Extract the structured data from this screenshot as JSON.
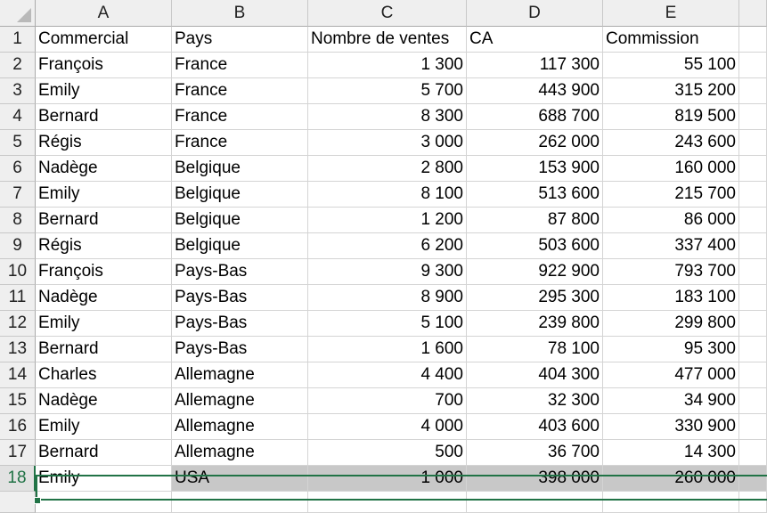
{
  "columns": [
    "A",
    "B",
    "C",
    "D",
    "E"
  ],
  "selected_row": "18",
  "rows": [
    {
      "n": "1",
      "a": "Commercial",
      "b": "Pays",
      "c": "Nombre de ventes",
      "d": "CA",
      "e": "Commission"
    },
    {
      "n": "2",
      "a": "François",
      "b": "France",
      "c": "1 300",
      "d": "117 300",
      "e": "55 100"
    },
    {
      "n": "3",
      "a": "Emily",
      "b": "France",
      "c": "5 700",
      "d": "443 900",
      "e": "315 200"
    },
    {
      "n": "4",
      "a": "Bernard",
      "b": "France",
      "c": "8 300",
      "d": "688 700",
      "e": "819 500"
    },
    {
      "n": "5",
      "a": "Régis",
      "b": "France",
      "c": "3 000",
      "d": "262 000",
      "e": "243 600"
    },
    {
      "n": "6",
      "a": "Nadège",
      "b": "Belgique",
      "c": "2 800",
      "d": "153 900",
      "e": "160 000"
    },
    {
      "n": "7",
      "a": "Emily",
      "b": "Belgique",
      "c": "8 100",
      "d": "513 600",
      "e": "215 700"
    },
    {
      "n": "8",
      "a": "Bernard",
      "b": "Belgique",
      "c": "1 200",
      "d": "87 800",
      "e": "86 000"
    },
    {
      "n": "9",
      "a": "Régis",
      "b": "Belgique",
      "c": "6 200",
      "d": "503 600",
      "e": "337 400"
    },
    {
      "n": "10",
      "a": "François",
      "b": "Pays-Bas",
      "c": "9 300",
      "d": "922 900",
      "e": "793 700"
    },
    {
      "n": "11",
      "a": "Nadège",
      "b": "Pays-Bas",
      "c": "8 900",
      "d": "295 300",
      "e": "183 100"
    },
    {
      "n": "12",
      "a": "Emily",
      "b": "Pays-Bas",
      "c": "5 100",
      "d": "239 800",
      "e": "299 800"
    },
    {
      "n": "13",
      "a": "Bernard",
      "b": "Pays-Bas",
      "c": "1 600",
      "d": "78 100",
      "e": "95 300"
    },
    {
      "n": "14",
      "a": "Charles",
      "b": "Allemagne",
      "c": "4 400",
      "d": "404 300",
      "e": "477 000"
    },
    {
      "n": "15",
      "a": "Nadège",
      "b": "Allemagne",
      "c": "700",
      "d": "32 300",
      "e": "34 900"
    },
    {
      "n": "16",
      "a": "Emily",
      "b": "Allemagne",
      "c": "4 000",
      "d": "403 600",
      "e": "330 900"
    },
    {
      "n": "17",
      "a": "Bernard",
      "b": "Allemagne",
      "c": "500",
      "d": "36 700",
      "e": "14 300"
    },
    {
      "n": "18",
      "a": "Emily",
      "b": "USA",
      "c": "1 000",
      "d": "398 000",
      "e": "260 000"
    }
  ],
  "colors": {
    "accent": "#217346",
    "selection_fill": "#c8c8c8",
    "header_bg": "#efefef"
  }
}
